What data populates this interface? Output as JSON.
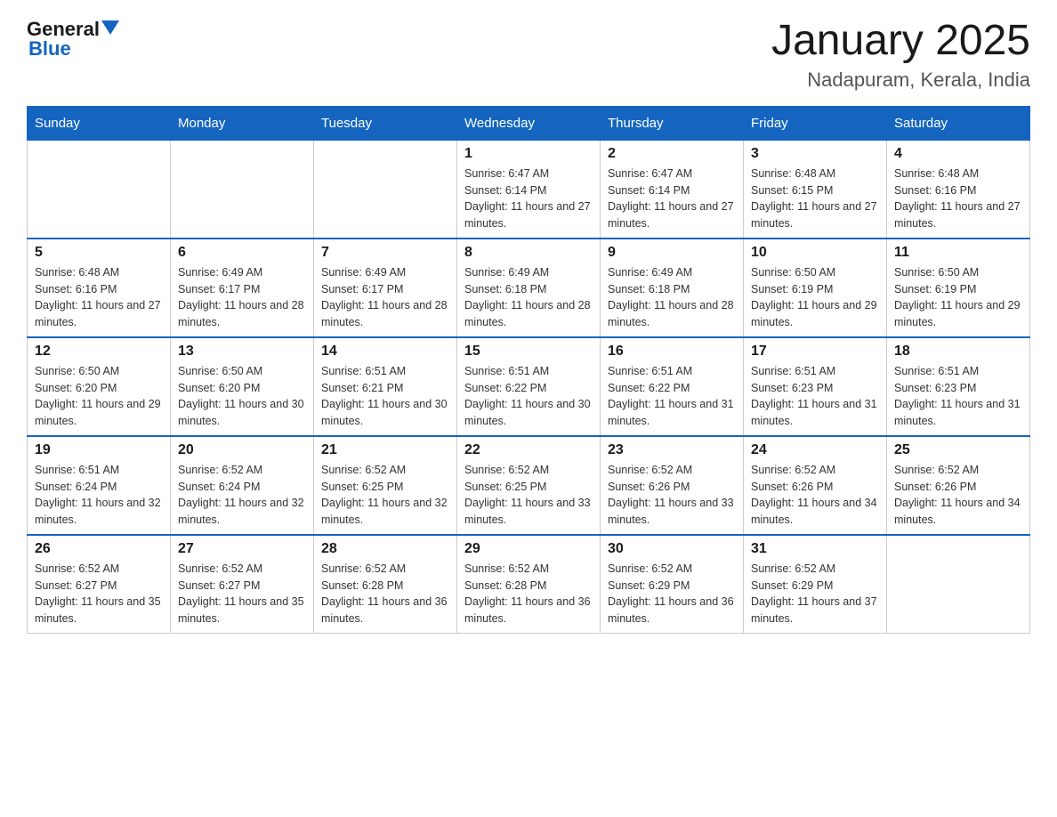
{
  "header": {
    "logo_general": "General",
    "logo_blue": "Blue",
    "title": "January 2025",
    "subtitle": "Nadapuram, Kerala, India"
  },
  "calendar": {
    "days_of_week": [
      "Sunday",
      "Monday",
      "Tuesday",
      "Wednesday",
      "Thursday",
      "Friday",
      "Saturday"
    ],
    "weeks": [
      [
        {
          "day": "",
          "sunrise": "",
          "sunset": "",
          "daylight": ""
        },
        {
          "day": "",
          "sunrise": "",
          "sunset": "",
          "daylight": ""
        },
        {
          "day": "",
          "sunrise": "",
          "sunset": "",
          "daylight": ""
        },
        {
          "day": "1",
          "sunrise": "Sunrise: 6:47 AM",
          "sunset": "Sunset: 6:14 PM",
          "daylight": "Daylight: 11 hours and 27 minutes."
        },
        {
          "day": "2",
          "sunrise": "Sunrise: 6:47 AM",
          "sunset": "Sunset: 6:14 PM",
          "daylight": "Daylight: 11 hours and 27 minutes."
        },
        {
          "day": "3",
          "sunrise": "Sunrise: 6:48 AM",
          "sunset": "Sunset: 6:15 PM",
          "daylight": "Daylight: 11 hours and 27 minutes."
        },
        {
          "day": "4",
          "sunrise": "Sunrise: 6:48 AM",
          "sunset": "Sunset: 6:16 PM",
          "daylight": "Daylight: 11 hours and 27 minutes."
        }
      ],
      [
        {
          "day": "5",
          "sunrise": "Sunrise: 6:48 AM",
          "sunset": "Sunset: 6:16 PM",
          "daylight": "Daylight: 11 hours and 27 minutes."
        },
        {
          "day": "6",
          "sunrise": "Sunrise: 6:49 AM",
          "sunset": "Sunset: 6:17 PM",
          "daylight": "Daylight: 11 hours and 28 minutes."
        },
        {
          "day": "7",
          "sunrise": "Sunrise: 6:49 AM",
          "sunset": "Sunset: 6:17 PM",
          "daylight": "Daylight: 11 hours and 28 minutes."
        },
        {
          "day": "8",
          "sunrise": "Sunrise: 6:49 AM",
          "sunset": "Sunset: 6:18 PM",
          "daylight": "Daylight: 11 hours and 28 minutes."
        },
        {
          "day": "9",
          "sunrise": "Sunrise: 6:49 AM",
          "sunset": "Sunset: 6:18 PM",
          "daylight": "Daylight: 11 hours and 28 minutes."
        },
        {
          "day": "10",
          "sunrise": "Sunrise: 6:50 AM",
          "sunset": "Sunset: 6:19 PM",
          "daylight": "Daylight: 11 hours and 29 minutes."
        },
        {
          "day": "11",
          "sunrise": "Sunrise: 6:50 AM",
          "sunset": "Sunset: 6:19 PM",
          "daylight": "Daylight: 11 hours and 29 minutes."
        }
      ],
      [
        {
          "day": "12",
          "sunrise": "Sunrise: 6:50 AM",
          "sunset": "Sunset: 6:20 PM",
          "daylight": "Daylight: 11 hours and 29 minutes."
        },
        {
          "day": "13",
          "sunrise": "Sunrise: 6:50 AM",
          "sunset": "Sunset: 6:20 PM",
          "daylight": "Daylight: 11 hours and 30 minutes."
        },
        {
          "day": "14",
          "sunrise": "Sunrise: 6:51 AM",
          "sunset": "Sunset: 6:21 PM",
          "daylight": "Daylight: 11 hours and 30 minutes."
        },
        {
          "day": "15",
          "sunrise": "Sunrise: 6:51 AM",
          "sunset": "Sunset: 6:22 PM",
          "daylight": "Daylight: 11 hours and 30 minutes."
        },
        {
          "day": "16",
          "sunrise": "Sunrise: 6:51 AM",
          "sunset": "Sunset: 6:22 PM",
          "daylight": "Daylight: 11 hours and 31 minutes."
        },
        {
          "day": "17",
          "sunrise": "Sunrise: 6:51 AM",
          "sunset": "Sunset: 6:23 PM",
          "daylight": "Daylight: 11 hours and 31 minutes."
        },
        {
          "day": "18",
          "sunrise": "Sunrise: 6:51 AM",
          "sunset": "Sunset: 6:23 PM",
          "daylight": "Daylight: 11 hours and 31 minutes."
        }
      ],
      [
        {
          "day": "19",
          "sunrise": "Sunrise: 6:51 AM",
          "sunset": "Sunset: 6:24 PM",
          "daylight": "Daylight: 11 hours and 32 minutes."
        },
        {
          "day": "20",
          "sunrise": "Sunrise: 6:52 AM",
          "sunset": "Sunset: 6:24 PM",
          "daylight": "Daylight: 11 hours and 32 minutes."
        },
        {
          "day": "21",
          "sunrise": "Sunrise: 6:52 AM",
          "sunset": "Sunset: 6:25 PM",
          "daylight": "Daylight: 11 hours and 32 minutes."
        },
        {
          "day": "22",
          "sunrise": "Sunrise: 6:52 AM",
          "sunset": "Sunset: 6:25 PM",
          "daylight": "Daylight: 11 hours and 33 minutes."
        },
        {
          "day": "23",
          "sunrise": "Sunrise: 6:52 AM",
          "sunset": "Sunset: 6:26 PM",
          "daylight": "Daylight: 11 hours and 33 minutes."
        },
        {
          "day": "24",
          "sunrise": "Sunrise: 6:52 AM",
          "sunset": "Sunset: 6:26 PM",
          "daylight": "Daylight: 11 hours and 34 minutes."
        },
        {
          "day": "25",
          "sunrise": "Sunrise: 6:52 AM",
          "sunset": "Sunset: 6:26 PM",
          "daylight": "Daylight: 11 hours and 34 minutes."
        }
      ],
      [
        {
          "day": "26",
          "sunrise": "Sunrise: 6:52 AM",
          "sunset": "Sunset: 6:27 PM",
          "daylight": "Daylight: 11 hours and 35 minutes."
        },
        {
          "day": "27",
          "sunrise": "Sunrise: 6:52 AM",
          "sunset": "Sunset: 6:27 PM",
          "daylight": "Daylight: 11 hours and 35 minutes."
        },
        {
          "day": "28",
          "sunrise": "Sunrise: 6:52 AM",
          "sunset": "Sunset: 6:28 PM",
          "daylight": "Daylight: 11 hours and 36 minutes."
        },
        {
          "day": "29",
          "sunrise": "Sunrise: 6:52 AM",
          "sunset": "Sunset: 6:28 PM",
          "daylight": "Daylight: 11 hours and 36 minutes."
        },
        {
          "day": "30",
          "sunrise": "Sunrise: 6:52 AM",
          "sunset": "Sunset: 6:29 PM",
          "daylight": "Daylight: 11 hours and 36 minutes."
        },
        {
          "day": "31",
          "sunrise": "Sunrise: 6:52 AM",
          "sunset": "Sunset: 6:29 PM",
          "daylight": "Daylight: 11 hours and 37 minutes."
        },
        {
          "day": "",
          "sunrise": "",
          "sunset": "",
          "daylight": ""
        }
      ]
    ]
  }
}
